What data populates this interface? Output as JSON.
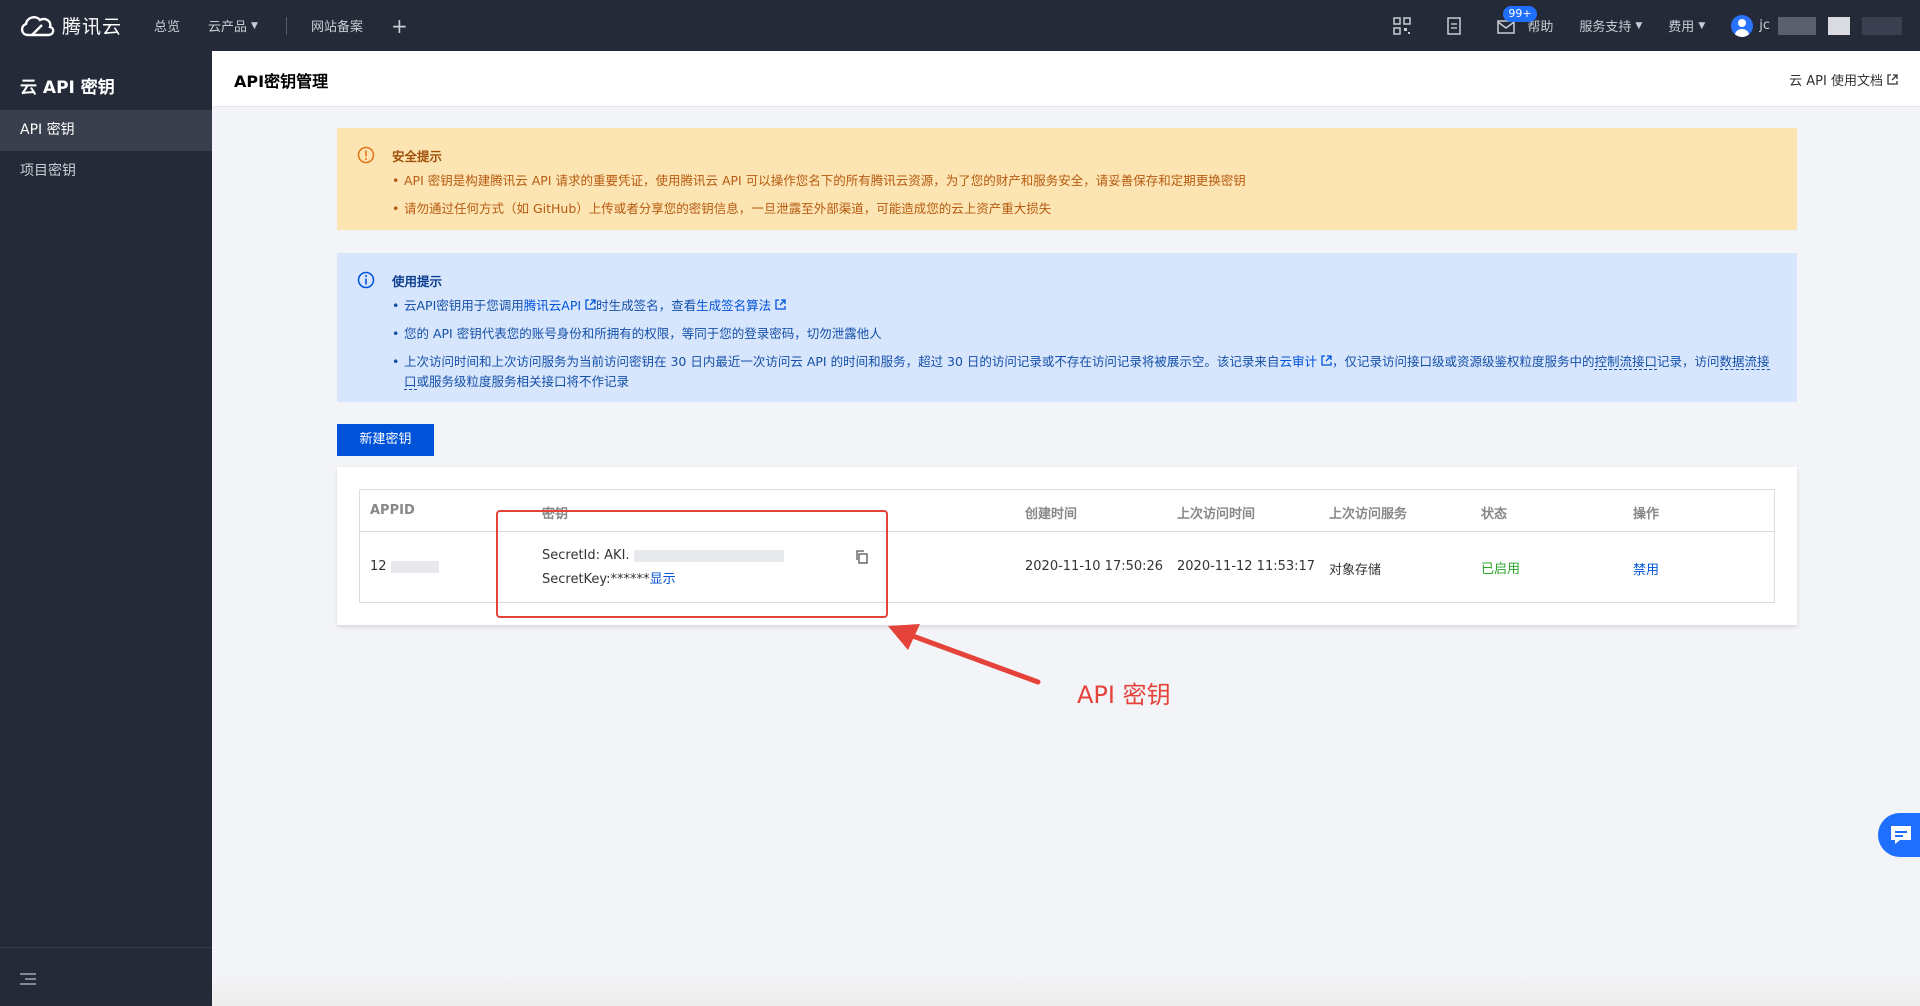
{
  "topbar": {
    "brand": "腾讯云",
    "nav": [
      "总览",
      "云产品",
      "网站备案"
    ],
    "help": "帮助",
    "support": "服务支持",
    "billing": "费用",
    "mail_badge": "99+",
    "username_prefix": "jc"
  },
  "sidebar": {
    "title": "云 API 密钥",
    "items": [
      "API 密钥",
      "项目密钥"
    ]
  },
  "page": {
    "title": "API密钥管理",
    "doc_link": "云 API 使用文档"
  },
  "warning": {
    "title": "安全提示",
    "lines": [
      "API 密钥是构建腾讯云 API 请求的重要凭证，使用腾讯云 API 可以操作您名下的所有腾讯云资源，为了您的财产和服务安全，请妥善保存和定期更换密钥",
      "请勿通过任何方式（如 GitHub）上传或者分享您的密钥信息，一旦泄露至外部渠道，可能造成您的云上资产重大损失"
    ]
  },
  "usage": {
    "title": "使用提示",
    "line1_a": "云API密钥用于您调用",
    "line1_link1": "腾讯云API",
    "line1_b": "时生成签名，查看",
    "line1_link2": "生成签名算法",
    "line2": "您的 API 密钥代表您的账号身份和所拥有的权限，等同于您的登录密码，切勿泄露他人",
    "line3_a": "上次访问时间和上次访问服务为当前访问密钥在 30 日内最近一次访问云 API 的时间和服务，超过 30 日的访问记录或不存在访问记录将被展示空。该记录来自",
    "line3_link": "云审计",
    "line3_b": "，仅记录访问接口级或资源级鉴权粒度服务中的",
    "line3_dash1": "控制流接口",
    "line3_c": "记录，访问",
    "line3_dash2": "数据流接口",
    "line3_d": "或服务级粒度服务相关接口将不作记录"
  },
  "new_key_button": "新建密钥",
  "table": {
    "headers": [
      "APPID",
      "密钥",
      "创建时间",
      "上次访问时间",
      "上次访问服务",
      "状态",
      "操作"
    ],
    "row": {
      "appid": "12",
      "secret_id_label": "SecretId: AKI.",
      "secret_key_label": "SecretKey:******",
      "show": "显示",
      "created": "2020-11-10 17:50:26",
      "last_access": "2020-11-12 11:53:17",
      "last_service": "对象存储",
      "status": "已启用",
      "action": "禁用"
    }
  },
  "annotation": "API 密钥",
  "colors": {
    "accent": "#0052d9",
    "annotation": "#e5423a",
    "enabled": "#29a329"
  }
}
